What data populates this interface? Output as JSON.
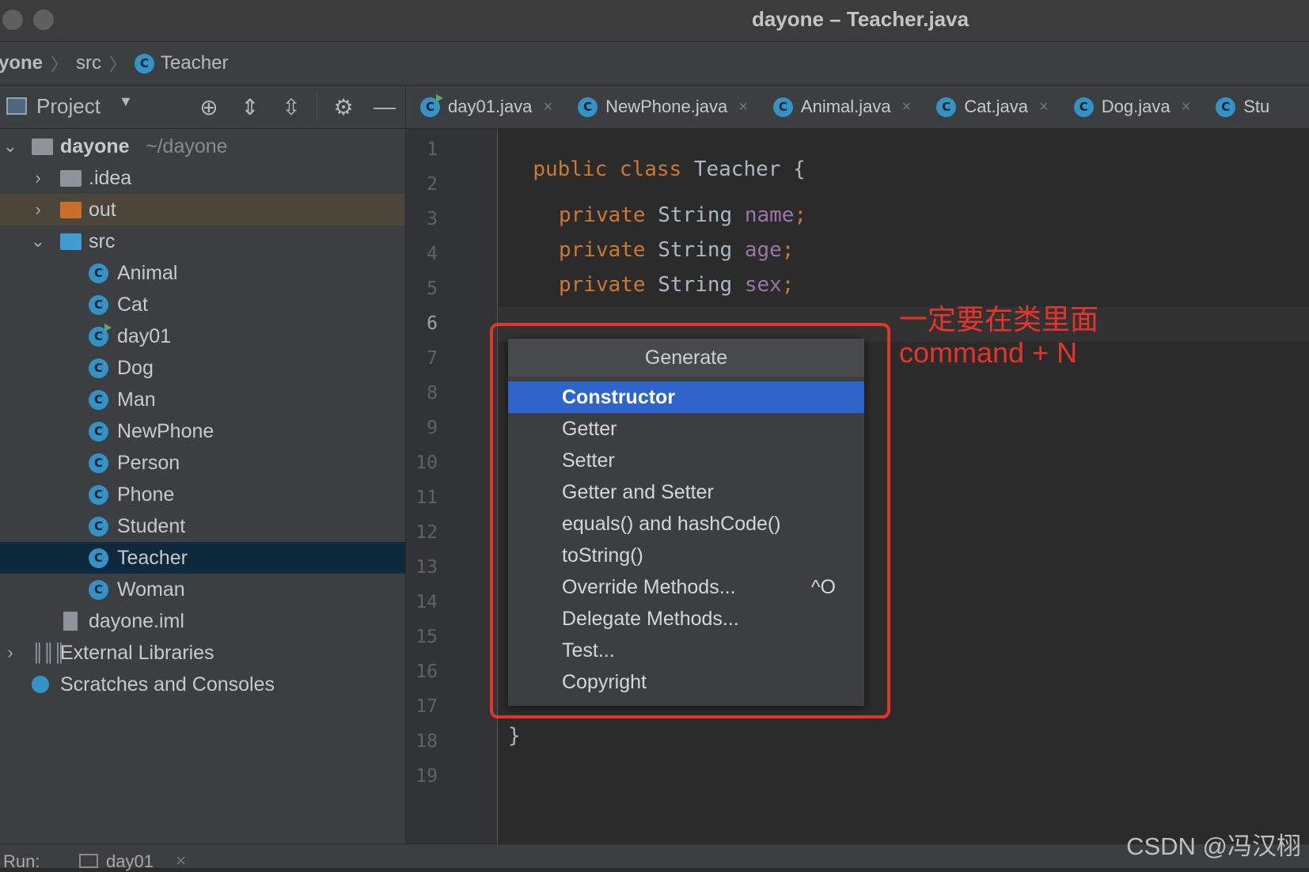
{
  "window": {
    "title": "dayone – Teacher.java"
  },
  "breadcrumb": {
    "items": [
      "yone",
      "src",
      "Teacher"
    ]
  },
  "project_panel": {
    "label": "Project"
  },
  "tree": {
    "root": {
      "label": "dayone",
      "path": "~/dayone"
    },
    "idea": ".idea",
    "out": "out",
    "src": "src",
    "classes": [
      "Animal",
      "Cat",
      "day01",
      "Dog",
      "Man",
      "NewPhone",
      "Person",
      "Phone",
      "Student",
      "Teacher",
      "Woman"
    ],
    "iml": "dayone.iml",
    "external": "External Libraries",
    "scratches": "Scratches and Consoles"
  },
  "tabs": [
    "day01.java",
    "NewPhone.java",
    "Animal.java",
    "Cat.java",
    "Dog.java",
    "Stu"
  ],
  "editor": {
    "line_numbers": [
      "1",
      "2",
      "3",
      "4",
      "5",
      "6",
      "7",
      "8",
      "9",
      "10",
      "11",
      "12",
      "13",
      "14",
      "15",
      "16",
      "17",
      "18",
      "19"
    ],
    "current_line": "6",
    "l1": {
      "kw1": "public",
      "kw2": "class",
      "name": "Teacher",
      "brace": "{"
    },
    "fields": [
      {
        "kw": "private",
        "type": "String",
        "name": "name",
        "semi": ";"
      },
      {
        "kw": "private",
        "type": "String",
        "name": "age",
        "semi": ";"
      },
      {
        "kw": "private",
        "type": "String",
        "name": "sex",
        "semi": ";"
      }
    ],
    "closing": "}"
  },
  "popup": {
    "title": "Generate",
    "items": [
      {
        "label": "Constructor",
        "shortcut": ""
      },
      {
        "label": "Getter",
        "shortcut": ""
      },
      {
        "label": "Setter",
        "shortcut": ""
      },
      {
        "label": "Getter and Setter",
        "shortcut": ""
      },
      {
        "label": "equals() and hashCode()",
        "shortcut": ""
      },
      {
        "label": "toString()",
        "shortcut": ""
      },
      {
        "label": "Override Methods...",
        "shortcut": "^O"
      },
      {
        "label": "Delegate Methods...",
        "shortcut": ""
      },
      {
        "label": "Test...",
        "shortcut": ""
      },
      {
        "label": "Copyright",
        "shortcut": ""
      }
    ],
    "selected": "Constructor"
  },
  "annotation": {
    "line1": "一定要在类里面",
    "line2": "command + N"
  },
  "bottom": {
    "run_label": "Run:",
    "run_config": "day01"
  },
  "watermark": "CSDN @冯汉栩",
  "colors": {
    "keyword": "#cc7832",
    "field": "#9876aa",
    "selection": "#2f65ca",
    "annotation": "#e5352b"
  }
}
